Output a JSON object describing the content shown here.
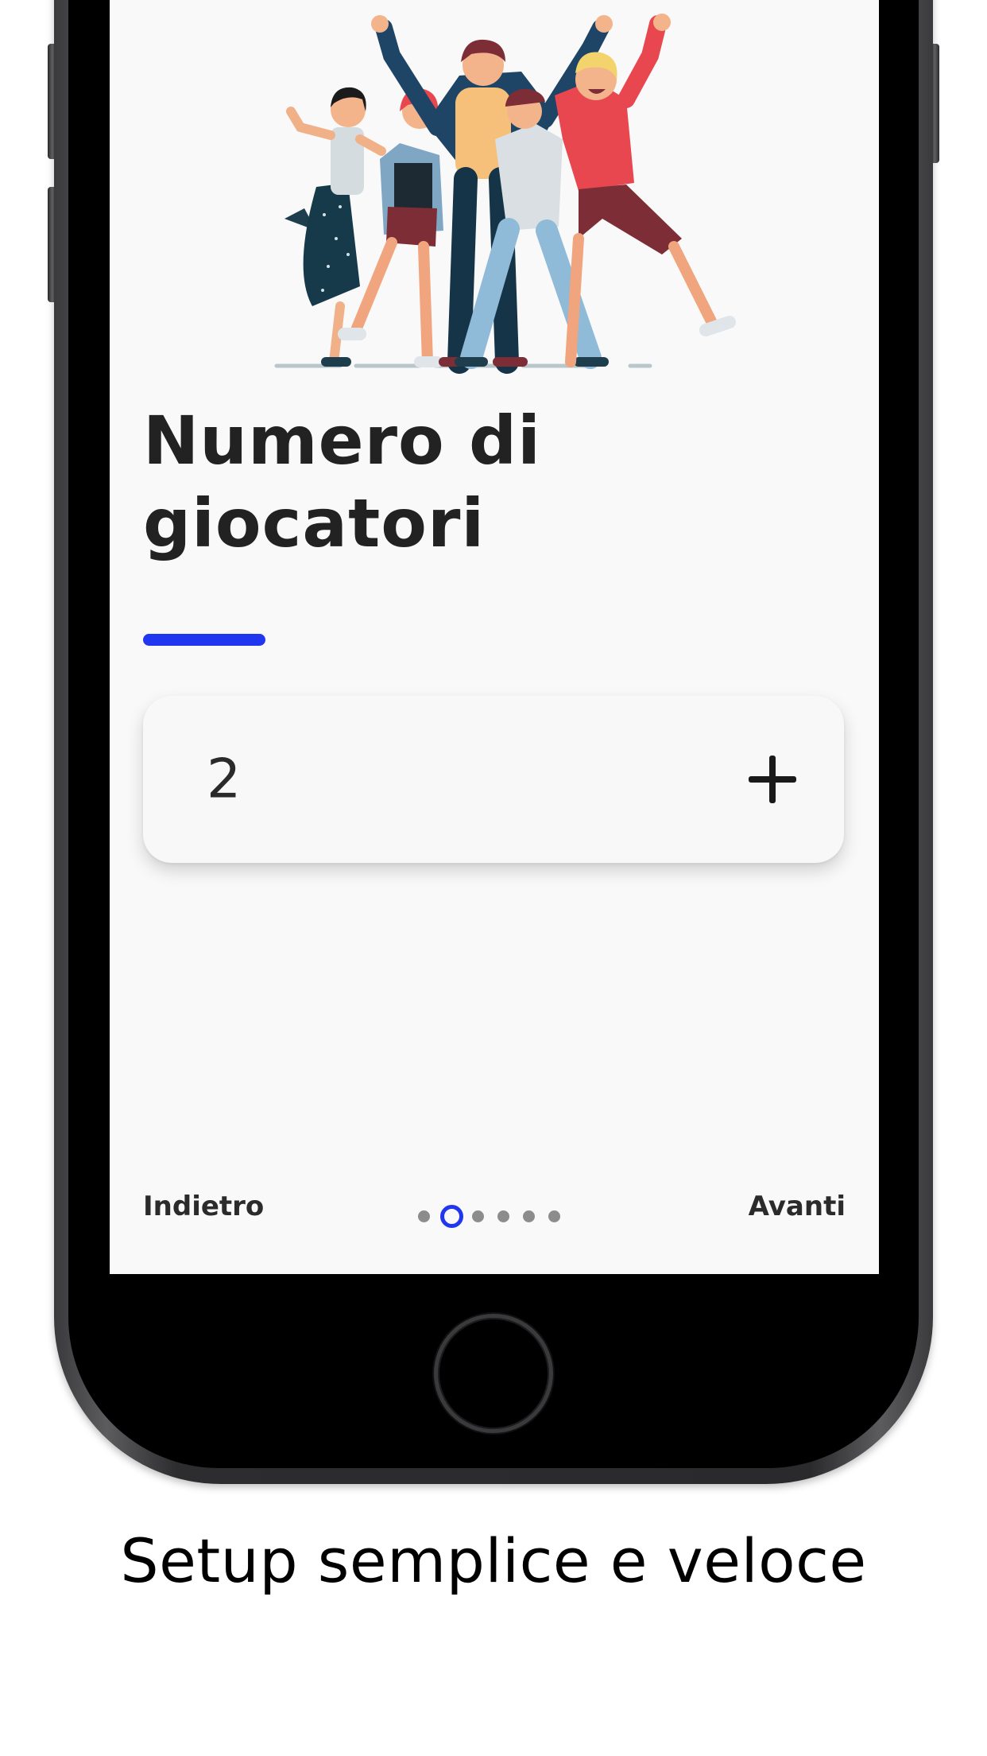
{
  "screen": {
    "title_line1": "Numero di",
    "title_line2": "giocatori",
    "accent_color": "#2136ef",
    "stepper": {
      "value": "2",
      "increment_icon": "plus-icon"
    },
    "footer": {
      "back_label": "Indietro",
      "next_label": "Avanti",
      "page_indicator": {
        "total": 6,
        "current": 2
      }
    }
  },
  "caption": "Setup semplice e veloce"
}
